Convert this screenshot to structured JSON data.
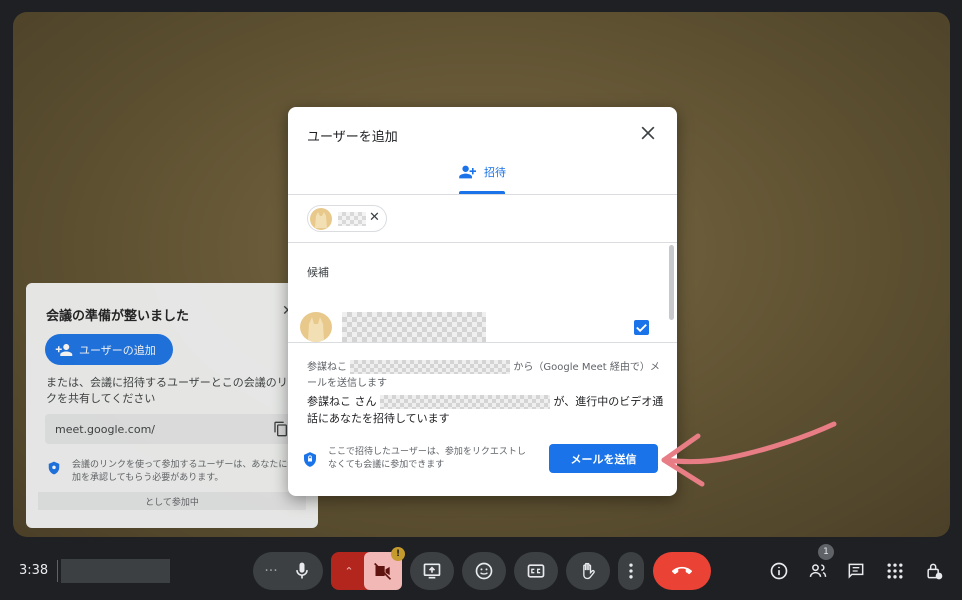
{
  "ready_panel": {
    "title": "会議の準備が整いました",
    "add_user_label": "ユーザーの追加",
    "description": "または、会議に招待するユーザーとこの会議のリンクを共有してください",
    "link": "meet.google.com/",
    "note": "会議のリンクを使って参加するユーザーは、あなたに参加を承認してもらう必要があります。",
    "footer": "として参加中"
  },
  "dialog": {
    "title": "ユーザーを追加",
    "tab_invite": "招待",
    "section_label": "候補",
    "message_line1_prefix": "参謀ねこ",
    "message_line1_suffix": "から（Google Meet 経由で）メールを送信します",
    "message_line2_prefix": "参謀ねこ さん",
    "message_line2_suffix": "が、進行中のビデオ通話にあなたを招待しています",
    "security_note": "ここで招待したユーザーは、参加をリクエストしなくても会議に参加できます",
    "send_button": "メールを送信"
  },
  "bottom_bar": {
    "time": "3:38",
    "camera_badge": "!",
    "participants_count": "1"
  },
  "colors": {
    "accent": "#1a73e8",
    "end_call": "#b3261e",
    "annotation_arrow": "#e87d86"
  }
}
